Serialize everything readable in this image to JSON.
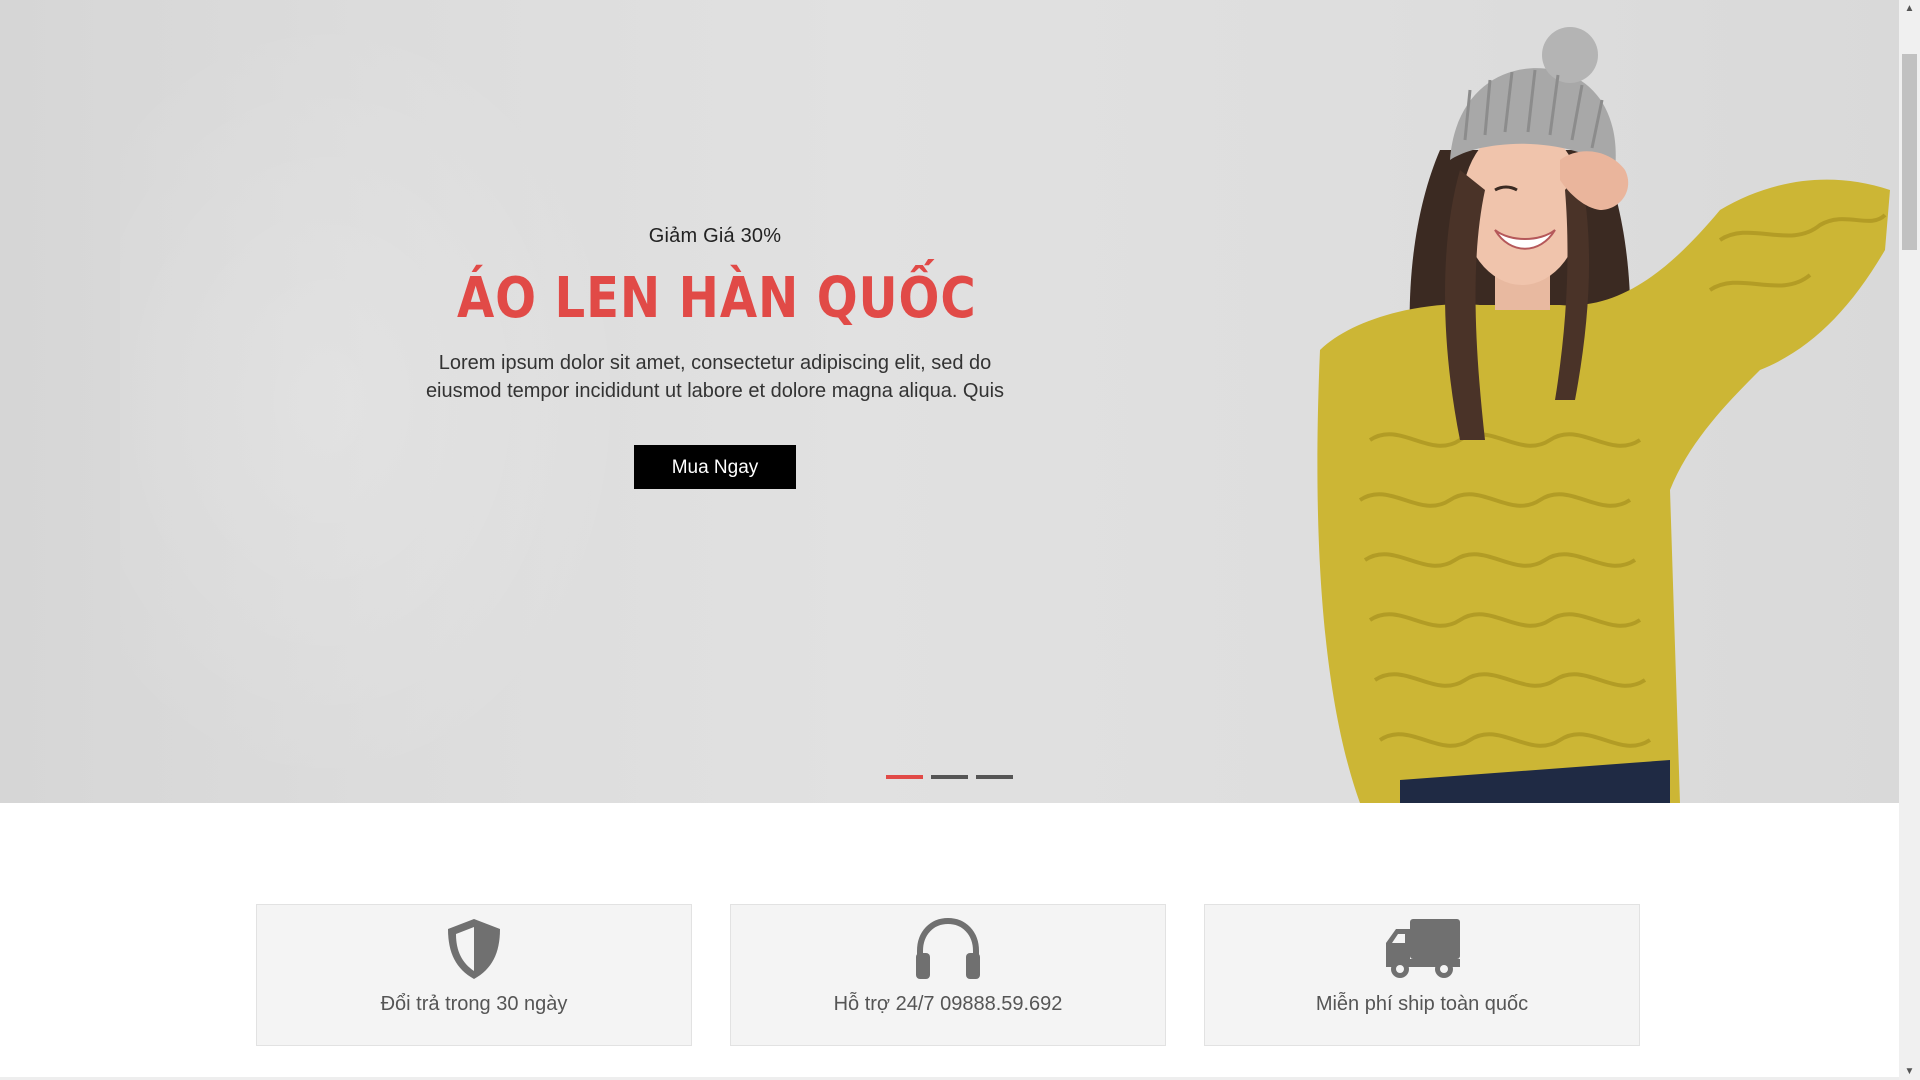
{
  "hero": {
    "subtitle": "Giảm Giá 30%",
    "title": "ÁO LEN HÀN QUỐC",
    "description": "Lorem ipsum dolor sit amet, consectetur adipiscing elit, sed do eiusmod tempor incididunt ut labore et dolore magna aliqua. Quis",
    "button_label": "Mua Ngay",
    "accent_color": "#e14a47",
    "slide_count": 3,
    "active_slide": 1
  },
  "features": [
    {
      "icon": "shield-icon",
      "label": "Đổi trả trong 30 ngày"
    },
    {
      "icon": "headphones-icon",
      "label": "Hỗ trợ 24/7 09888.59.692"
    },
    {
      "icon": "truck-icon",
      "label": "Miễn phí ship toàn quốc"
    }
  ],
  "scrollbar": {
    "up_glyph": "▲",
    "down_glyph": "▼"
  }
}
